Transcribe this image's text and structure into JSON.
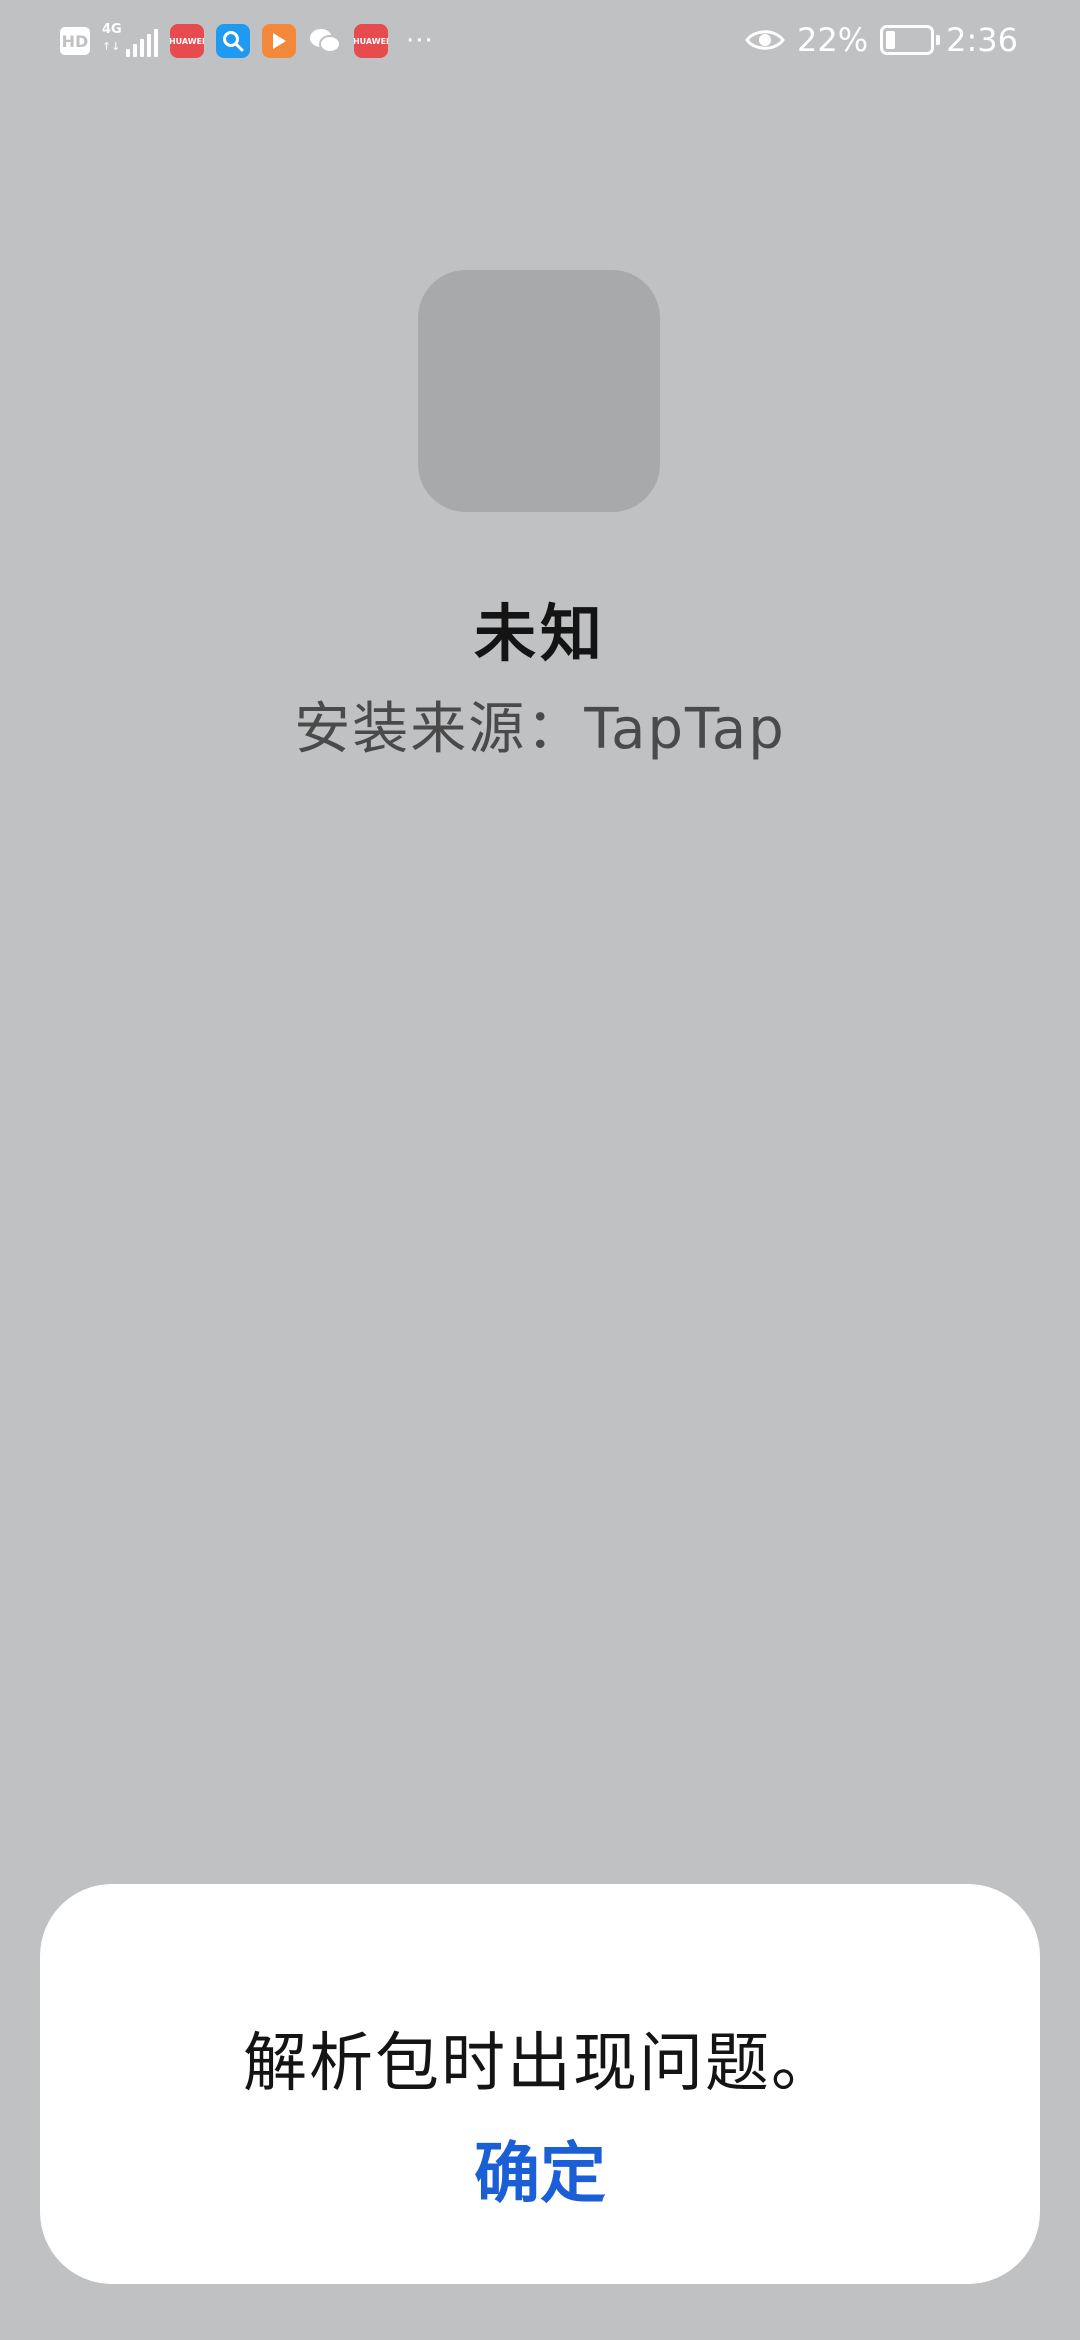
{
  "status_bar": {
    "hd_label": "HD",
    "network_label": "4G",
    "network_arrows": "↑↓",
    "notifications": [
      {
        "icon": "huawei-appgallery-icon",
        "label": "HUAWEI"
      },
      {
        "icon": "search-icon",
        "label": ""
      },
      {
        "icon": "video-play-icon",
        "label": ""
      },
      {
        "icon": "wechat-icon",
        "label": ""
      },
      {
        "icon": "huawei-appgallery-icon",
        "label": "HUAWEI"
      }
    ],
    "more": "···",
    "battery_percent": "22%",
    "battery_level": 0.22,
    "time": "2:36"
  },
  "app": {
    "name": "未知",
    "install_source": "安装来源：TapTap"
  },
  "dialog": {
    "message": "解析包时出现问题。",
    "confirm_label": "确定"
  },
  "colors": {
    "background": "#c0c1c3",
    "icon_placeholder": "#a8a9ab",
    "accent": "#1a5fd6",
    "dialog_bg": "#ffffff"
  }
}
